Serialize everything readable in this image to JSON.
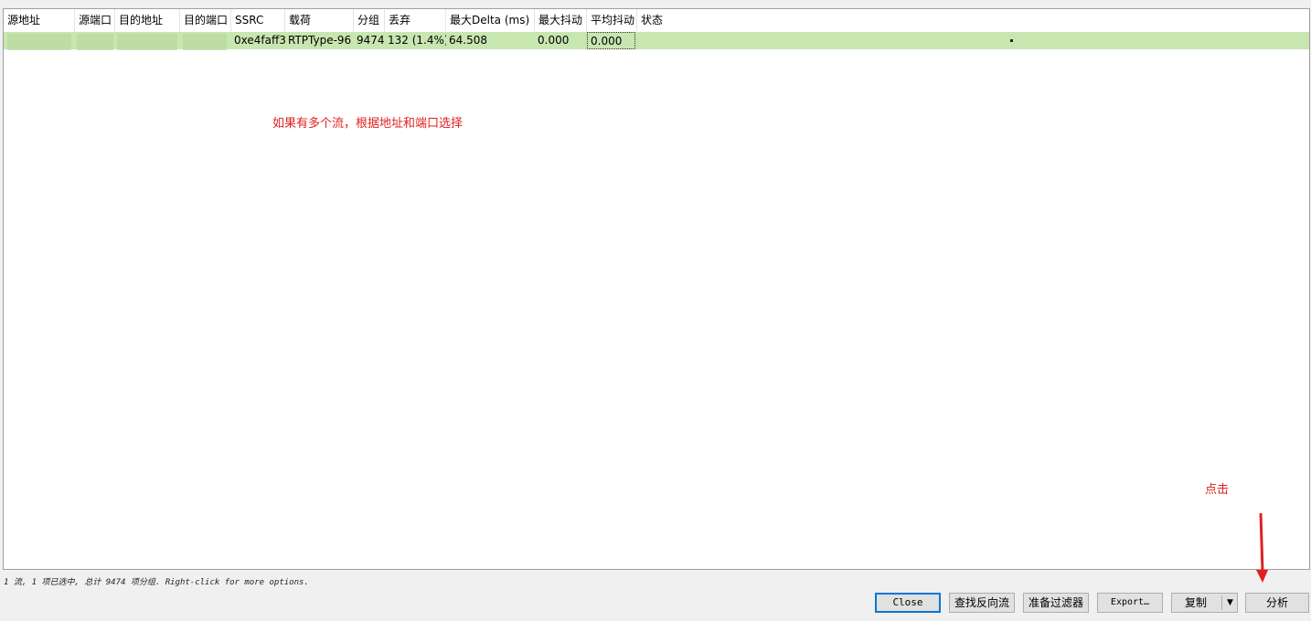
{
  "columns": [
    {
      "key": "src_addr",
      "label": "源地址"
    },
    {
      "key": "src_port",
      "label": "源端口"
    },
    {
      "key": "dst_addr",
      "label": "目的地址"
    },
    {
      "key": "dst_port",
      "label": "目的端口"
    },
    {
      "key": "ssrc",
      "label": "SSRC"
    },
    {
      "key": "payload",
      "label": "载荷"
    },
    {
      "key": "packets",
      "label": "分组"
    },
    {
      "key": "lost",
      "label": "丢弃"
    },
    {
      "key": "max_delta",
      "label": "最大Delta (ms)"
    },
    {
      "key": "max_jitter",
      "label": "最大抖动"
    },
    {
      "key": "mean_jitter",
      "label": "平均抖动"
    },
    {
      "key": "status",
      "label": "状态"
    }
  ],
  "row": {
    "ssrc": "0xe4faff3",
    "payload": "RTPType-96",
    "packets": "9474",
    "lost": "132 (1.4%)",
    "max_delta": "64.508",
    "max_jitter": "0.000",
    "mean_jitter": "0.000"
  },
  "annotations": {
    "stream_hint": "如果有多个流，根据地址和端口选择",
    "click_hint": "点击"
  },
  "status_line": "1 流, 1 项已选中, 总计 9474 项分组. Right-click for more options.",
  "buttons": {
    "close": "Close",
    "find_reverse": "查找反向流",
    "prepare_filter": "准备过滤器",
    "export": "Export…",
    "copy": "复制",
    "analyze": "分析"
  },
  "colors": {
    "selected_row": "#c8e6b0",
    "annotation": "#e02020"
  }
}
